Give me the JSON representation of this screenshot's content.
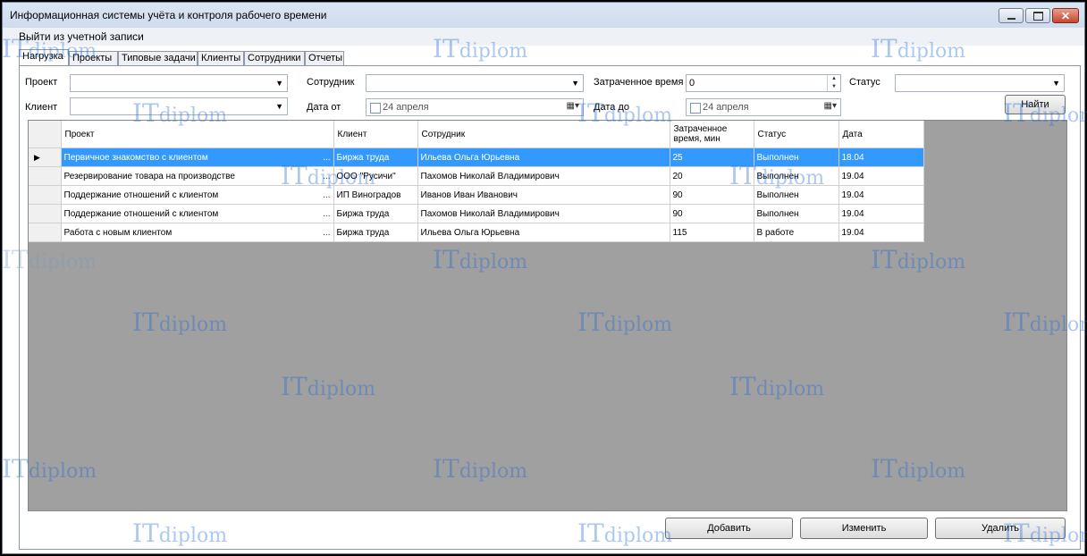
{
  "window": {
    "title": "Информационная системы учёта и контроля рабочего времени"
  },
  "menu": {
    "logout": "Выйти из учетной записи"
  },
  "tabs": [
    {
      "label": "Нагрузка",
      "active": true
    },
    {
      "label": "Проекты",
      "active": false
    },
    {
      "label": "Типовые задачи",
      "active": false
    },
    {
      "label": "Клиенты",
      "active": false
    },
    {
      "label": "Сотрудники",
      "active": false
    },
    {
      "label": "Отчеты",
      "active": false
    }
  ],
  "filters": {
    "project_label": "Проект",
    "project_value": "",
    "client_label": "Клиент",
    "client_value": "",
    "employee_label": "Сотрудник",
    "employee_value": "",
    "date_from_label": "Дата от",
    "date_from_value": "24  апреля",
    "time_spent_label": "Затраченное время",
    "time_spent_value": "0",
    "date_to_label": "Дата до",
    "date_to_value": "24  апреля",
    "status_label": "Статус",
    "status_value": ""
  },
  "buttons": {
    "find": "Найти",
    "add": "Добавить",
    "edit": "Изменить",
    "delete": "Удалить"
  },
  "grid": {
    "columns": [
      "Проект",
      "Клиент",
      "Сотрудник",
      "Затраченное время, мин",
      "Статус",
      "Дата"
    ],
    "rows": [
      [
        "Первичное знакомство с клиентом",
        "Биржа труда",
        "Ильева Ольга Юрьевна",
        "25",
        "Выполнен",
        "18.04"
      ],
      [
        "Резервирование товара на производстве",
        "ООО \"Русичи\"",
        "Пахомов Николай Владимирович",
        "20",
        "Выполнен",
        "19.04"
      ],
      [
        "Поддержание отношений с клиентом",
        "ИП Виноградов",
        "Иванов Иван Иванович",
        "90",
        "Выполнен",
        "19.04"
      ],
      [
        "Поддержание отношений с клиентом",
        "Биржа труда",
        "Пахомов Николай Владимирович",
        "90",
        "Выполнен",
        "19.04"
      ],
      [
        "Работа с новым клиентом",
        "Биржа труда",
        "Ильева Ольга Юрьевна",
        "115",
        "В работе",
        "19.04"
      ]
    ],
    "selected_row": 0
  },
  "watermark": {
    "it": "IT",
    "diplom": "diplom"
  },
  "icons": {
    "dropdown": "chevron-down-icon",
    "calendar": "calendar-icon",
    "row-pointer": "row-pointer-icon"
  }
}
